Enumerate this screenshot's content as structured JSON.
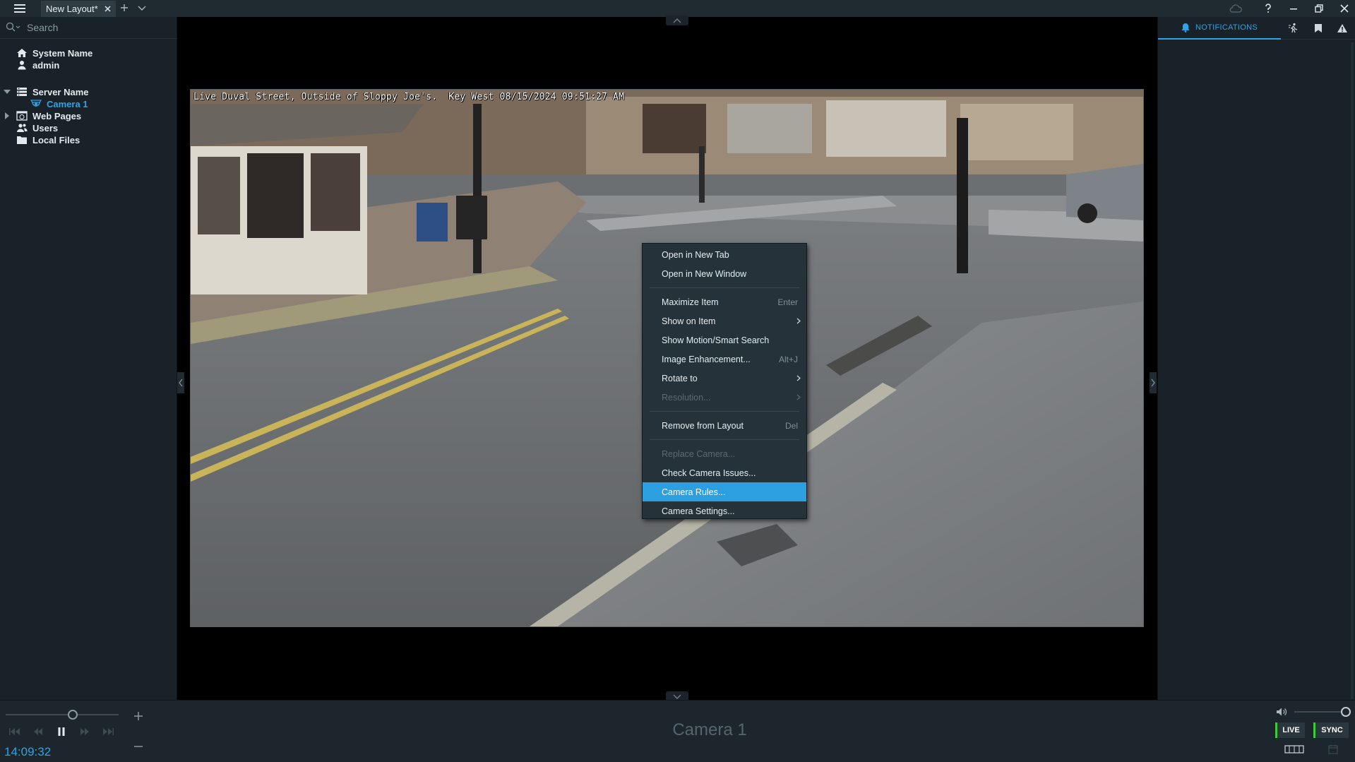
{
  "titlebar": {
    "tab_title": "New Layout*"
  },
  "left_panel": {
    "search_placeholder": "Search",
    "tree": {
      "system_name": "System Name",
      "user": "admin",
      "server_name": "Server Name",
      "camera": "Camera 1",
      "web_pages": "Web Pages",
      "users": "Users",
      "local_files": "Local Files"
    }
  },
  "right_panel": {
    "notifications_tab": "NOTIFICATIONS"
  },
  "camera_tile": {
    "osd_text": "Live Duval Street, Outside of Sloppy Joe's.  Key West 08/15/2024 09:51:27 AM"
  },
  "context_menu": {
    "items": [
      {
        "label": "Open in New Tab",
        "shortcut": ""
      },
      {
        "label": "Open in New Window",
        "shortcut": ""
      },
      {
        "label": "Maximize Item",
        "shortcut": "Enter"
      },
      {
        "label": "Show on Item",
        "shortcut": ""
      },
      {
        "label": "Show Motion/Smart Search",
        "shortcut": ""
      },
      {
        "label": "Image Enhancement...",
        "shortcut": "Alt+J"
      },
      {
        "label": "Rotate to",
        "shortcut": ""
      },
      {
        "label": "Resolution...",
        "shortcut": ""
      },
      {
        "label": "Remove from Layout",
        "shortcut": "Del"
      },
      {
        "label": "Replace Camera...",
        "shortcut": ""
      },
      {
        "label": "Check Camera Issues...",
        "shortcut": ""
      },
      {
        "label": "Camera Rules...",
        "shortcut": ""
      },
      {
        "label": "Camera Settings...",
        "shortcut": ""
      }
    ]
  },
  "bottom_bar": {
    "time": "14:09:32",
    "camera_name": "Camera 1",
    "live_label": "LIVE",
    "sync_label": "SYNC"
  },
  "colors": {
    "accent": "#2b9fe0",
    "live_indicator": "#3ec93e",
    "panel_bg": "#182228"
  }
}
